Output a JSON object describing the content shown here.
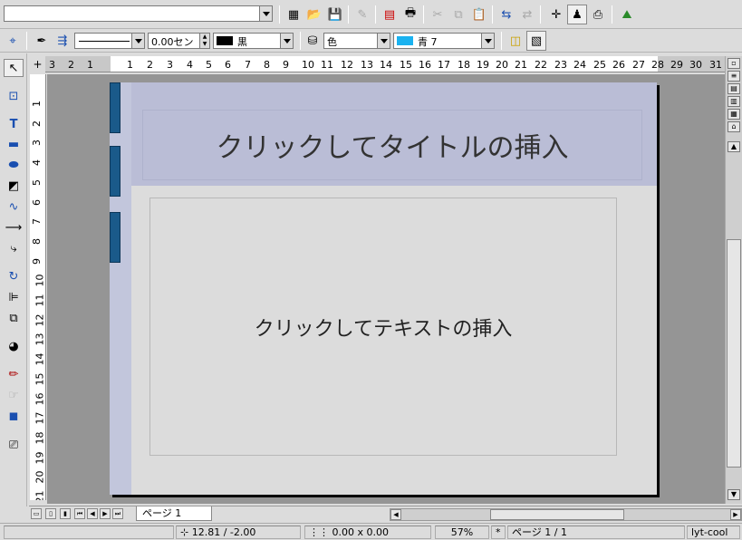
{
  "toolbar1": {
    "style_value": "",
    "icons": [
      "navigator-icon",
      "open-icon",
      "save-icon",
      "edit-icon",
      "export-pdf-icon",
      "print-icon",
      "cut-icon",
      "copy-icon",
      "paste-icon",
      "undo-icon",
      "redo-icon",
      "cursor-icon",
      "navigator2-icon",
      "preview-icon",
      "gallery-icon"
    ]
  },
  "toolbar2": {
    "line_width": "0.00セン",
    "line_color": "黒",
    "line_color_swatch": "#000000",
    "fill_type": "色",
    "fill_color": "青 7",
    "fill_color_swatch": "#1ab2f0"
  },
  "ruler": {
    "h_ticks": [
      "3",
      "2",
      "1",
      "1",
      "2",
      "3",
      "4",
      "5",
      "6",
      "7",
      "8",
      "9",
      "10",
      "11",
      "12",
      "13",
      "14",
      "15",
      "16",
      "17",
      "18",
      "19",
      "20",
      "21",
      "22",
      "23",
      "24",
      "25",
      "26",
      "27",
      "28",
      "29",
      "30",
      "31"
    ],
    "v_ticks": [
      "1",
      "2",
      "3",
      "4",
      "5",
      "6",
      "7",
      "8",
      "9",
      "10",
      "11",
      "12",
      "13",
      "14",
      "15",
      "16",
      "17",
      "18",
      "19",
      "20",
      "21"
    ]
  },
  "slide": {
    "title_placeholder": "クリックしてタイトルの挿入",
    "body_placeholder": "クリックしてテキストの挿入"
  },
  "tabs": {
    "page_tab": "ページ 1"
  },
  "status": {
    "position": "12.81 / -2.00",
    "size": "0.00 x 0.00",
    "zoom": "57%",
    "modified": "*",
    "page": "ページ 1 / 1",
    "layout": "lyt-cool"
  }
}
